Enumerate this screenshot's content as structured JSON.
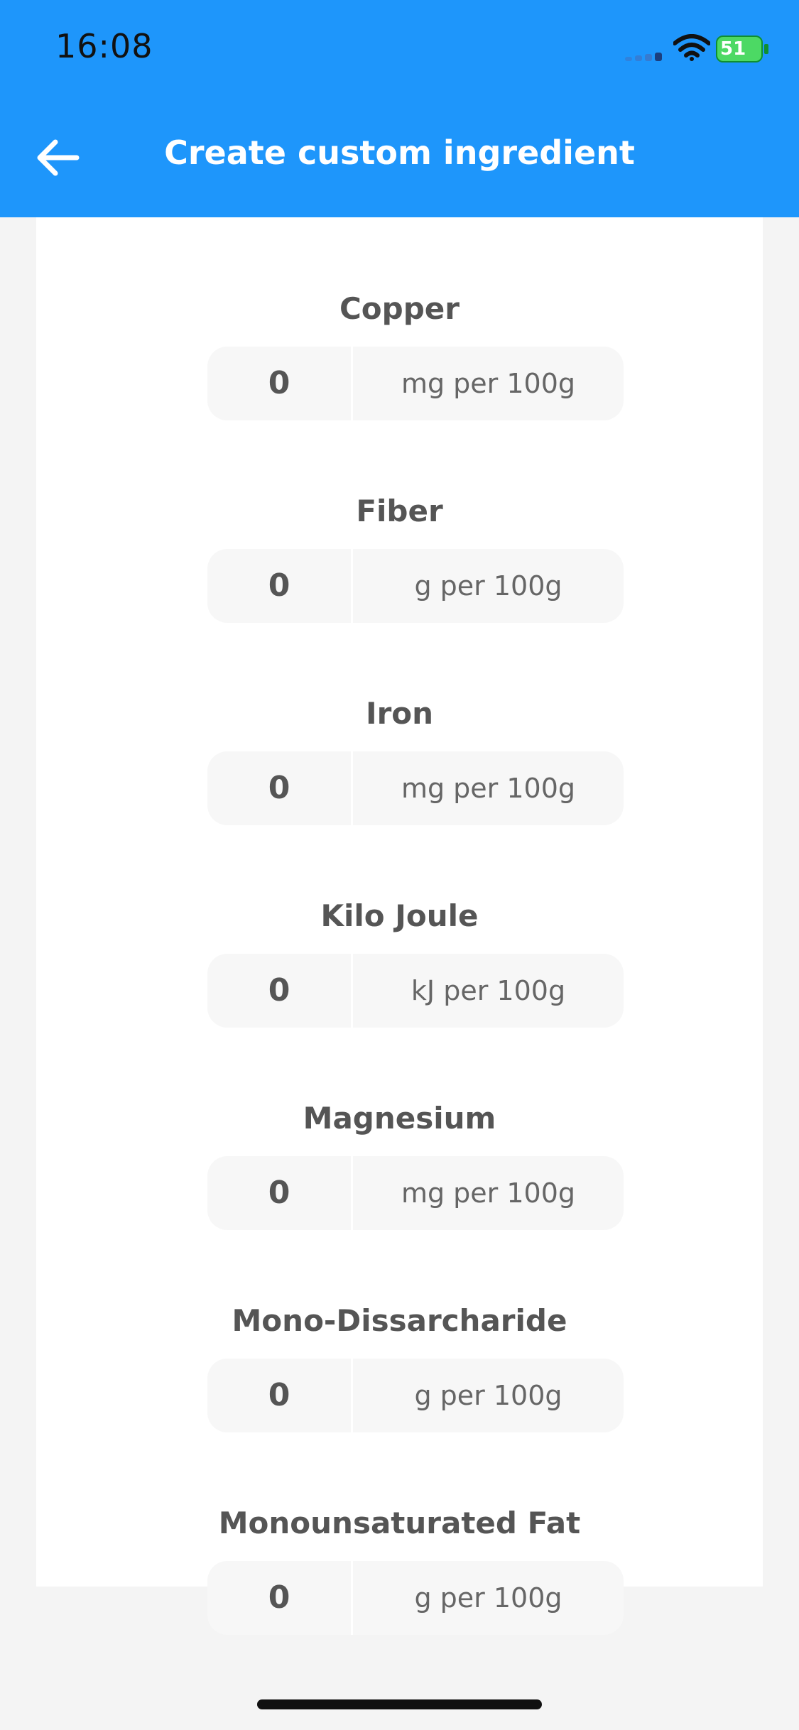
{
  "status_bar": {
    "time": "16:08",
    "battery": "51"
  },
  "header": {
    "title": "Create custom ingredient",
    "background_color": "#1e96fb"
  },
  "fields": [
    {
      "label": "Copper",
      "value": "0",
      "unit": "mg per 100g"
    },
    {
      "label": "Fiber",
      "value": "0",
      "unit": "g per 100g"
    },
    {
      "label": "Iron",
      "value": "0",
      "unit": "mg per 100g"
    },
    {
      "label": "Kilo Joule",
      "value": "0",
      "unit": "kJ per 100g"
    },
    {
      "label": "Magnesium",
      "value": "0",
      "unit": "mg per 100g"
    },
    {
      "label": "Mono-Dissarcharide",
      "value": "0",
      "unit": "g per 100g"
    },
    {
      "label": "Monounsaturated Fat",
      "value": "0",
      "unit": "g per 100g"
    }
  ]
}
